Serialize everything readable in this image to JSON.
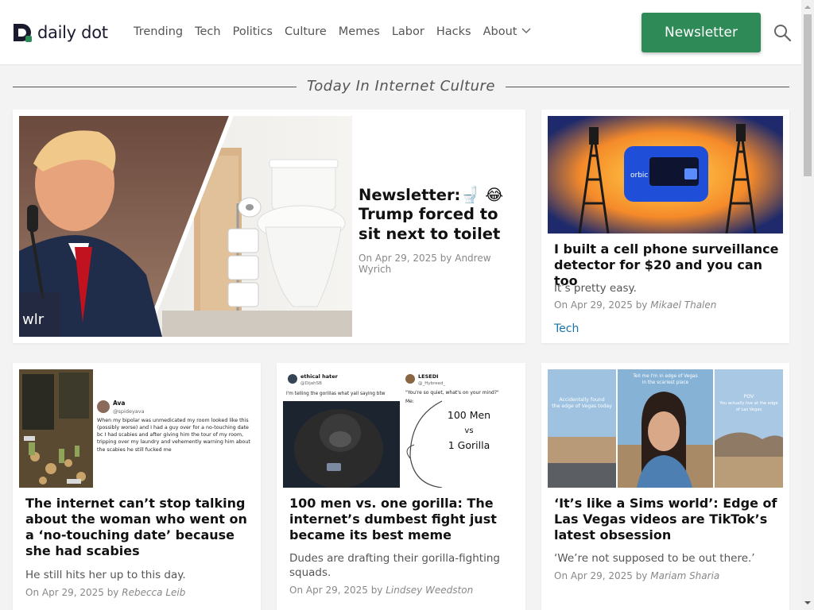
{
  "brand": {
    "name": "daily dot",
    "accent": "#2e8b57",
    "logo_mark_color": "#1a1a2e",
    "logo_dot_color": "#2e8b57"
  },
  "nav": {
    "items": [
      "Trending",
      "Tech",
      "Politics",
      "Culture",
      "Memes",
      "Labor",
      "Hacks",
      "About"
    ],
    "about_has_dropdown": true
  },
  "header": {
    "newsletter_label": "Newsletter",
    "search_icon": "search-icon"
  },
  "section": {
    "title": "Today In Internet Culture"
  },
  "featured": {
    "headline": "Newsletter:🚽 😂 Trump forced to sit next to toilet",
    "meta_prefix": "On Apr 29, 2025 by ",
    "author": "Andrew Wyrich"
  },
  "side": {
    "headline": "I built a cell phone surveillance detector for $20 and you can too",
    "dek": "It’s pretty easy.",
    "meta_prefix": "On Apr 29, 2025 by ",
    "author": "Mikael Thalen",
    "tag": "Tech",
    "image_text": "orbic"
  },
  "row": [
    {
      "headline": "The internet can’t stop talking about the woman who went on a ‘no-touching date’ because she had scabies",
      "dek": "He still hits her up to this day.",
      "meta_prefix": "On Apr 29, 2025 by ",
      "author": "Rebecca Leib",
      "image": {
        "name": "Ava",
        "handle": "@spideyava",
        "tweet": "When my bipolar was unmedicated my room looked like this (possibly worse) and I had a guy over for a no-touching date bc I had scabies and after giving him the tour of my room, tripping over my laundry and vehemently warning him about the scabies he still fucked me"
      }
    },
    {
      "headline": "100 men vs. one gorilla: The internet’s dumbest fight just became its best meme",
      "dek": "Dudes are drafting their gorilla-fighting squads.",
      "meta_prefix": "On Apr 29, 2025 by ",
      "author": "Lindsey Weedston",
      "image": {
        "left_name": "ethical hater",
        "left_handle": "@DijahSB",
        "left_text": "I'm telling the gorillas what yall saying btw",
        "right_name": "LESEDI",
        "right_handle": "@_Hybreed_",
        "right_quote": "\"You're so quiet, what's on your mind?\"",
        "right_me": "Me:",
        "line1": "100 Men",
        "line2": "vs",
        "line3": "1 Gorilla"
      }
    },
    {
      "headline": "‘It’s like a Sims world’: Edge of Las Vegas videos are TikTok’s latest obsession",
      "dek": "‘We’re not supposed to be out there.’",
      "meta_prefix": "On Apr 29, 2025 by ",
      "author": "Mariam Sharia",
      "image": {
        "left_caption_1": "Accidentally found",
        "left_caption_2": "the edge of Vegas today",
        "mid_caption_1": "Tell me I'm in edge of Vegas",
        "mid_caption_2": "in the scariest place",
        "right_caption_1": "POV",
        "right_caption_2": "You actually live at the edge",
        "right_caption_3": "of Las Vegas"
      }
    }
  ]
}
